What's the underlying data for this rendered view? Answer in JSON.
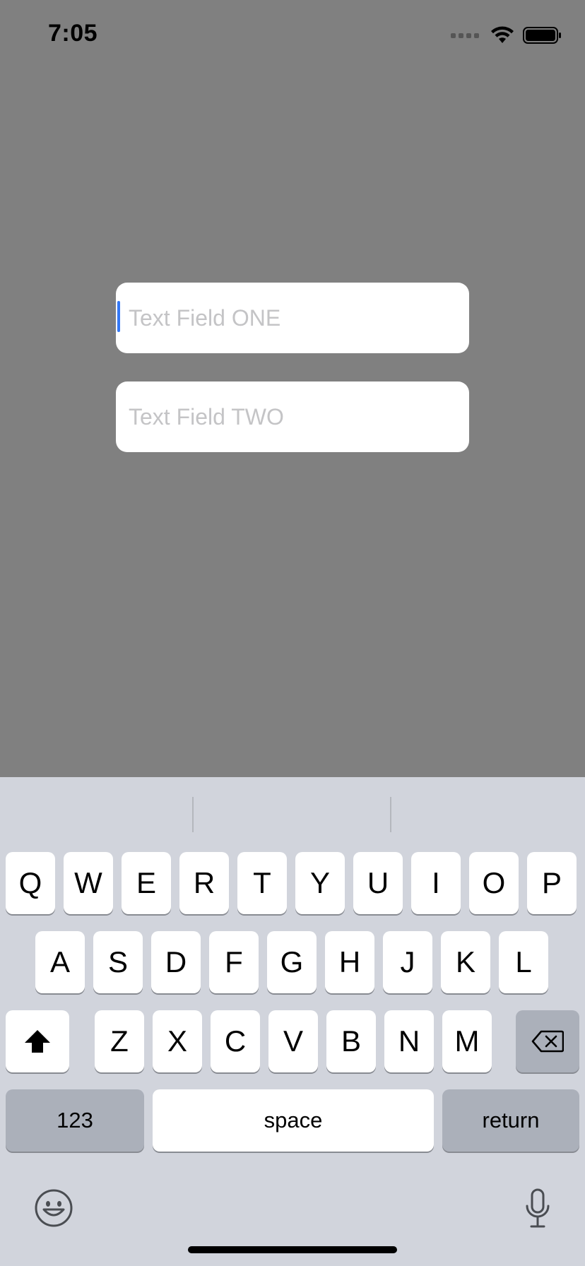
{
  "status_bar": {
    "time": "7:05"
  },
  "fields": {
    "one_placeholder": "Text Field ONE",
    "two_placeholder": "Text Field TWO",
    "caret_color": "#3478f6"
  },
  "keyboard": {
    "row1": [
      "Q",
      "W",
      "E",
      "R",
      "T",
      "Y",
      "U",
      "I",
      "O",
      "P"
    ],
    "row2": [
      "A",
      "S",
      "D",
      "F",
      "G",
      "H",
      "J",
      "K",
      "L"
    ],
    "row3": [
      "Z",
      "X",
      "C",
      "V",
      "B",
      "N",
      "M"
    ],
    "numbers_label": "123",
    "space_label": "space",
    "return_label": "return",
    "icons": {
      "shift": "shift-arrow",
      "delete": "backspace",
      "emoji": "smiley-face",
      "dictation": "microphone"
    }
  },
  "colors": {
    "background": "#808080",
    "keyboard_bg": "#d1d4dc",
    "key_light": "#ffffff",
    "key_dark": "#abb0ba"
  }
}
